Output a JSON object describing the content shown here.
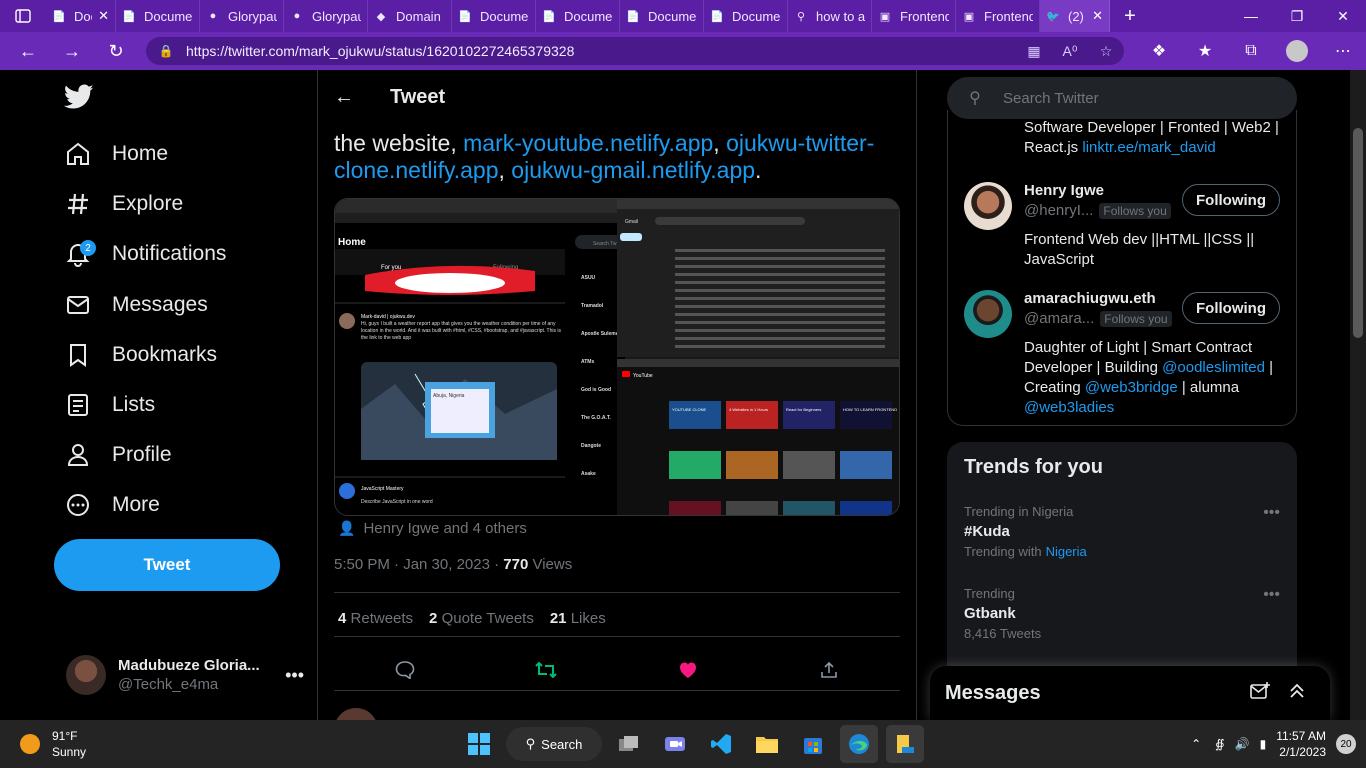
{
  "browser": {
    "tabs": [
      {
        "title": "Doc",
        "icon": "doc-icon"
      },
      {
        "title": "Documer",
        "icon": "doc-icon"
      },
      {
        "title": "Glorypau",
        "icon": "github-icon"
      },
      {
        "title": "Glorypau",
        "icon": "github-icon"
      },
      {
        "title": "Domain r",
        "icon": "diamond-icon"
      },
      {
        "title": "Documer",
        "icon": "doc-icon"
      },
      {
        "title": "Documer",
        "icon": "doc-icon"
      },
      {
        "title": "Documer",
        "icon": "doc-icon"
      },
      {
        "title": "Documer",
        "icon": "doc-icon"
      },
      {
        "title": "how to a",
        "icon": "search-icon"
      },
      {
        "title": "Frontend",
        "icon": "page-icon"
      },
      {
        "title": "Frontend",
        "icon": "page-icon"
      },
      {
        "title": "(2) M",
        "icon": "twitter-icon"
      }
    ],
    "url": "https://twitter.com/mark_ojukwu/status/1620102272465379328",
    "accent": "#5b1fa6"
  },
  "nav": {
    "items": [
      {
        "label": "Home",
        "icon": "home-icon"
      },
      {
        "label": "Explore",
        "icon": "hashtag-icon"
      },
      {
        "label": "Notifications",
        "icon": "bell-icon",
        "badge": "2"
      },
      {
        "label": "Messages",
        "icon": "envelope-icon"
      },
      {
        "label": "Bookmarks",
        "icon": "bookmark-icon"
      },
      {
        "label": "Lists",
        "icon": "list-icon"
      },
      {
        "label": "Profile",
        "icon": "person-icon"
      },
      {
        "label": "More",
        "icon": "more-circle-icon"
      }
    ],
    "tweet_button": "Tweet",
    "user": {
      "name": "Madubueze Gloria...",
      "handle": "@Techk_e4ma"
    }
  },
  "tweet": {
    "header_title": "Tweet",
    "text_prefix": "the website, ",
    "link1": "mark-youtube.netlify.app",
    "sep1": ", ",
    "link2": "ojukwu-twitter-clone.netlify.app",
    "sep2": ", ",
    "link3": "ojukwu-gmail.netlify.app",
    "text_suffix": ".",
    "liked_by": "Henry Igwe and 4 others",
    "time": "5:50 PM · Jan 30, 2023 · ",
    "views_count": "770",
    "views_label": " Views",
    "retweets_count": "4",
    "retweets_label": "Retweets",
    "quotes_count": "2",
    "quotes_label": "Quote Tweets",
    "likes_count": "21",
    "likes_label": "Likes",
    "like_color": "#f91880",
    "retweet_color": "#00ba7c"
  },
  "media": {
    "home_label": "Home",
    "for_you": "For you",
    "following": "Following",
    "post1_author": "Mark-david | ojukwu.dev",
    "post1_text": "Hi, guys I built a weather report app that gives you the weather condition per time of any location in the world. And it was built with #html, #CSS, #bootstrap, and #javascript. This is the link to the web app",
    "weather_city": "Abuja, Nigeria",
    "post2_author": "JavaScript Mastery",
    "post2_text": "Describe JavaScript in one word",
    "search_label": "Search Tw",
    "trends": [
      "ASUU",
      "Tramadol",
      "Apostle Suleman",
      "ATMs",
      "God is Good",
      "The G.O.A.T.",
      "Dangote",
      "Asake"
    ],
    "gmail_label": "Gmail",
    "youtube_label": "YouTube",
    "yt_thumbs": [
      "YOUTUBE CLONE",
      "4 Websites in 1 Hours",
      "React for Beginners",
      "HOW TO LEARN FRONTEND"
    ]
  },
  "right": {
    "search_placeholder": "Search Twitter",
    "prev_bio": "Software Developer | Fronted | Web2 | React.js ",
    "prev_link": "linktr.ee/mark_david",
    "follows": [
      {
        "name": "Henry Igwe",
        "handle": "@henryI...",
        "follows_you": "Follows you",
        "button": "Following",
        "bio": "Frontend Web dev ||HTML ||CSS || JavaScript"
      },
      {
        "name": "amarachiugwu.eth",
        "handle": "@amara...",
        "follows_you": "Follows you",
        "button": "Following",
        "bio_a": "Daughter of Light | Smart Contract Developer | Building ",
        "bio_l1": "@oodleslimited",
        "bio_b": " | Creating ",
        "bio_l2": "@web3bridge",
        "bio_c": " | alumna ",
        "bio_l3": "@web3ladies"
      }
    ],
    "trends_title": "Trends for you",
    "trends": [
      {
        "context": "Trending in Nigeria",
        "name": "#Kuda",
        "extra_prefix": "Trending with",
        "extra_link": "Nigeria"
      },
      {
        "context": "Trending",
        "name": "Gtbank",
        "extra": "8,416 Tweets"
      }
    ],
    "messages_title": "Messages"
  },
  "taskbar": {
    "temp": "91°F",
    "condition": "Sunny",
    "search_label": "Search",
    "time": "11:57 AM",
    "date": "2/1/2023",
    "notif_count": "20"
  }
}
